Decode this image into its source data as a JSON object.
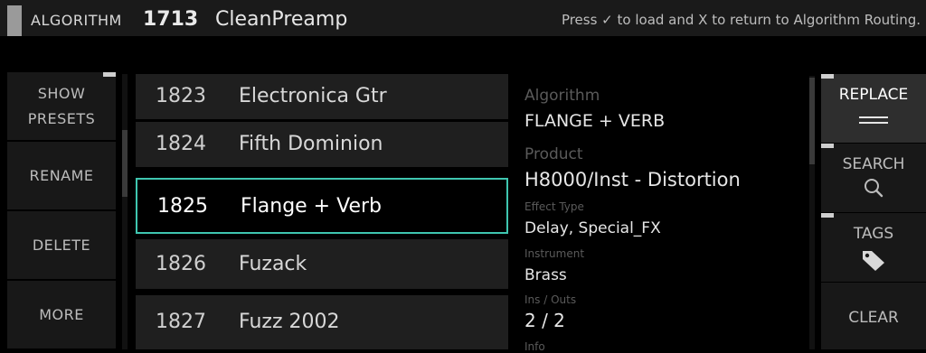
{
  "header": {
    "algorithm_label": "ALGORITHM",
    "algorithm_number": "1713",
    "algorithm_name": "CleanPreamp",
    "hint": "Press ✓ to load and X to return to Algorithm Routing."
  },
  "left_menu": {
    "show_presets": "SHOW PRESETS",
    "rename": "RENAME",
    "delete": "DELETE",
    "more": "MORE"
  },
  "presets": [
    {
      "number": "1823",
      "name": "Electronica Gtr"
    },
    {
      "number": "1824",
      "name": "Fifth Dominion"
    },
    {
      "number": "1825",
      "name": "Flange + Verb"
    },
    {
      "number": "1826",
      "name": "Fuzack"
    },
    {
      "number": "1827",
      "name": "Fuzz 2002"
    }
  ],
  "selected_index": 2,
  "info": {
    "algorithm_label": "Algorithm",
    "algorithm_value": "FLANGE + VERB",
    "product_label": "Product",
    "product_value": "H8000/Inst - Distortion",
    "effect_type_label": "Effect Type",
    "effect_type_value": "Delay, Special_FX",
    "instrument_label": "Instrument",
    "instrument_value": "Brass",
    "ins_outs_label": "Ins / Outs",
    "ins_outs_value": "2 / 2",
    "info_label": "Info"
  },
  "right_menu": {
    "replace": "REPLACE",
    "search": "SEARCH",
    "tags": "TAGS",
    "clear": "CLEAR"
  },
  "colors": {
    "selection_border": "#3fc6b0"
  }
}
